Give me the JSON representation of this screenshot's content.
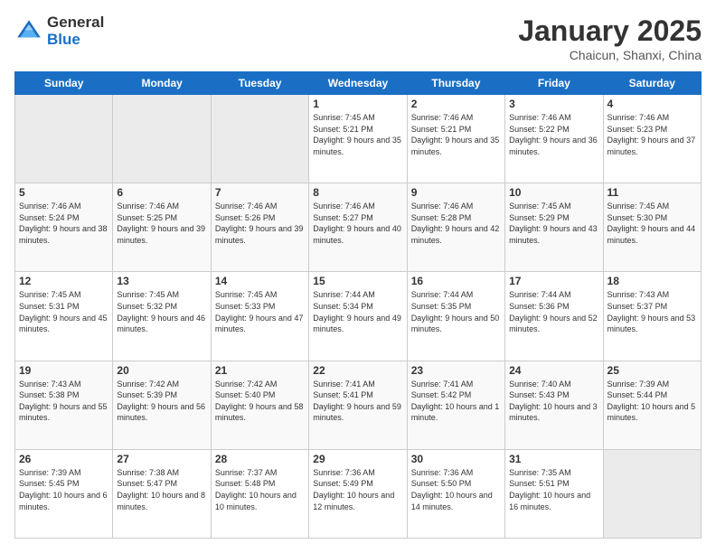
{
  "header": {
    "logo_general": "General",
    "logo_blue": "Blue",
    "month": "January 2025",
    "location": "Chaicun, Shanxi, China"
  },
  "weekdays": [
    "Sunday",
    "Monday",
    "Tuesday",
    "Wednesday",
    "Thursday",
    "Friday",
    "Saturday"
  ],
  "weeks": [
    [
      {
        "day": "",
        "info": ""
      },
      {
        "day": "",
        "info": ""
      },
      {
        "day": "",
        "info": ""
      },
      {
        "day": "1",
        "info": "Sunrise: 7:45 AM\nSunset: 5:21 PM\nDaylight: 9 hours and 35 minutes."
      },
      {
        "day": "2",
        "info": "Sunrise: 7:46 AM\nSunset: 5:21 PM\nDaylight: 9 hours and 35 minutes."
      },
      {
        "day": "3",
        "info": "Sunrise: 7:46 AM\nSunset: 5:22 PM\nDaylight: 9 hours and 36 minutes."
      },
      {
        "day": "4",
        "info": "Sunrise: 7:46 AM\nSunset: 5:23 PM\nDaylight: 9 hours and 37 minutes."
      }
    ],
    [
      {
        "day": "5",
        "info": "Sunrise: 7:46 AM\nSunset: 5:24 PM\nDaylight: 9 hours and 38 minutes."
      },
      {
        "day": "6",
        "info": "Sunrise: 7:46 AM\nSunset: 5:25 PM\nDaylight: 9 hours and 39 minutes."
      },
      {
        "day": "7",
        "info": "Sunrise: 7:46 AM\nSunset: 5:26 PM\nDaylight: 9 hours and 39 minutes."
      },
      {
        "day": "8",
        "info": "Sunrise: 7:46 AM\nSunset: 5:27 PM\nDaylight: 9 hours and 40 minutes."
      },
      {
        "day": "9",
        "info": "Sunrise: 7:46 AM\nSunset: 5:28 PM\nDaylight: 9 hours and 42 minutes."
      },
      {
        "day": "10",
        "info": "Sunrise: 7:45 AM\nSunset: 5:29 PM\nDaylight: 9 hours and 43 minutes."
      },
      {
        "day": "11",
        "info": "Sunrise: 7:45 AM\nSunset: 5:30 PM\nDaylight: 9 hours and 44 minutes."
      }
    ],
    [
      {
        "day": "12",
        "info": "Sunrise: 7:45 AM\nSunset: 5:31 PM\nDaylight: 9 hours and 45 minutes."
      },
      {
        "day": "13",
        "info": "Sunrise: 7:45 AM\nSunset: 5:32 PM\nDaylight: 9 hours and 46 minutes."
      },
      {
        "day": "14",
        "info": "Sunrise: 7:45 AM\nSunset: 5:33 PM\nDaylight: 9 hours and 47 minutes."
      },
      {
        "day": "15",
        "info": "Sunrise: 7:44 AM\nSunset: 5:34 PM\nDaylight: 9 hours and 49 minutes."
      },
      {
        "day": "16",
        "info": "Sunrise: 7:44 AM\nSunset: 5:35 PM\nDaylight: 9 hours and 50 minutes."
      },
      {
        "day": "17",
        "info": "Sunrise: 7:44 AM\nSunset: 5:36 PM\nDaylight: 9 hours and 52 minutes."
      },
      {
        "day": "18",
        "info": "Sunrise: 7:43 AM\nSunset: 5:37 PM\nDaylight: 9 hours and 53 minutes."
      }
    ],
    [
      {
        "day": "19",
        "info": "Sunrise: 7:43 AM\nSunset: 5:38 PM\nDaylight: 9 hours and 55 minutes."
      },
      {
        "day": "20",
        "info": "Sunrise: 7:42 AM\nSunset: 5:39 PM\nDaylight: 9 hours and 56 minutes."
      },
      {
        "day": "21",
        "info": "Sunrise: 7:42 AM\nSunset: 5:40 PM\nDaylight: 9 hours and 58 minutes."
      },
      {
        "day": "22",
        "info": "Sunrise: 7:41 AM\nSunset: 5:41 PM\nDaylight: 9 hours and 59 minutes."
      },
      {
        "day": "23",
        "info": "Sunrise: 7:41 AM\nSunset: 5:42 PM\nDaylight: 10 hours and 1 minute."
      },
      {
        "day": "24",
        "info": "Sunrise: 7:40 AM\nSunset: 5:43 PM\nDaylight: 10 hours and 3 minutes."
      },
      {
        "day": "25",
        "info": "Sunrise: 7:39 AM\nSunset: 5:44 PM\nDaylight: 10 hours and 5 minutes."
      }
    ],
    [
      {
        "day": "26",
        "info": "Sunrise: 7:39 AM\nSunset: 5:45 PM\nDaylight: 10 hours and 6 minutes."
      },
      {
        "day": "27",
        "info": "Sunrise: 7:38 AM\nSunset: 5:47 PM\nDaylight: 10 hours and 8 minutes."
      },
      {
        "day": "28",
        "info": "Sunrise: 7:37 AM\nSunset: 5:48 PM\nDaylight: 10 hours and 10 minutes."
      },
      {
        "day": "29",
        "info": "Sunrise: 7:36 AM\nSunset: 5:49 PM\nDaylight: 10 hours and 12 minutes."
      },
      {
        "day": "30",
        "info": "Sunrise: 7:36 AM\nSunset: 5:50 PM\nDaylight: 10 hours and 14 minutes."
      },
      {
        "day": "31",
        "info": "Sunrise: 7:35 AM\nSunset: 5:51 PM\nDaylight: 10 hours and 16 minutes."
      },
      {
        "day": "",
        "info": ""
      }
    ]
  ]
}
